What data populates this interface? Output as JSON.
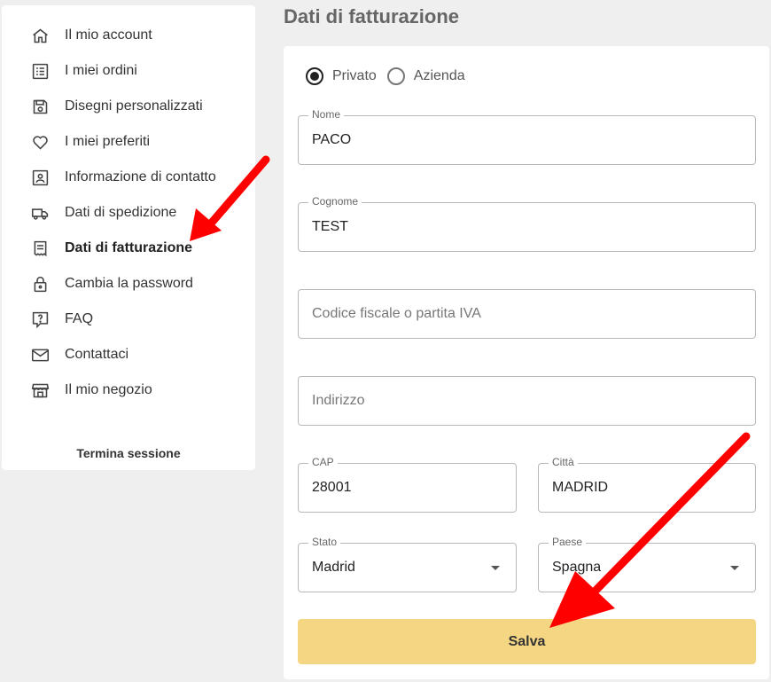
{
  "sidebar": {
    "items": [
      {
        "label": "Il mio account",
        "icon": "home-icon"
      },
      {
        "label": "I miei ordini",
        "icon": "list-icon"
      },
      {
        "label": "Disegni personalizzati",
        "icon": "save-icon"
      },
      {
        "label": "I miei preferiti",
        "icon": "heart-icon"
      },
      {
        "label": "Informazione di contatto",
        "icon": "contact-card-icon"
      },
      {
        "label": "Dati di spedizione",
        "icon": "truck-icon"
      },
      {
        "label": "Dati di fatturazione",
        "icon": "receipt-icon",
        "active": true
      },
      {
        "label": "Cambia la password",
        "icon": "lock-icon"
      },
      {
        "label": "FAQ",
        "icon": "question-icon"
      },
      {
        "label": "Contattaci",
        "icon": "mail-icon"
      },
      {
        "label": "Il mio negozio",
        "icon": "store-icon"
      }
    ],
    "logout_label": "Termina sessione"
  },
  "main": {
    "title": "Dati di fatturazione",
    "customer_type": {
      "options": [
        "Privato",
        "Azienda"
      ],
      "selected": "Privato"
    },
    "fields": {
      "nome": {
        "label": "Nome",
        "value": "PACO"
      },
      "cognome": {
        "label": "Cognome",
        "value": "TEST"
      },
      "codice_fiscale": {
        "placeholder": "Codice fiscale o partita IVA"
      },
      "indirizzo": {
        "placeholder": "Indirizzo"
      },
      "cap": {
        "label": "CAP",
        "value": "28001"
      },
      "citta": {
        "label": "Città",
        "value": "MADRID"
      },
      "stato": {
        "label": "Stato",
        "value": "Madrid"
      },
      "paese": {
        "label": "Paese",
        "value": "Spagna"
      }
    },
    "save_label": "Salva"
  },
  "colors": {
    "save_button": "#f5d683",
    "annotation_arrow": "#ff0000"
  }
}
